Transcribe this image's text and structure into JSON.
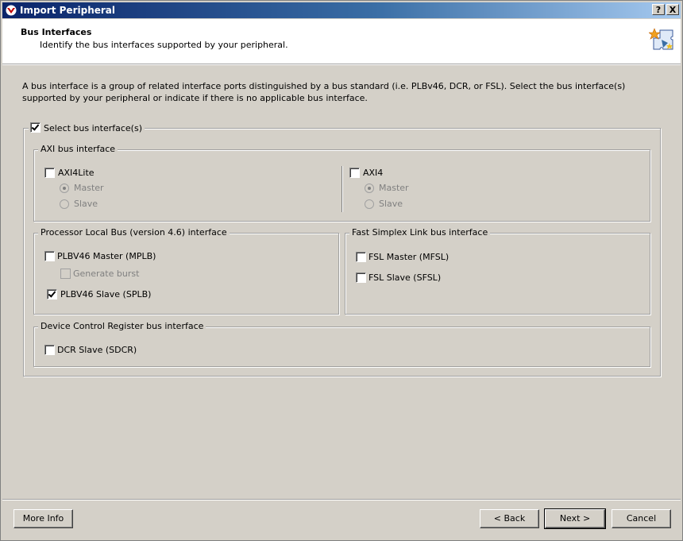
{
  "window": {
    "title": "Import Peripheral",
    "help_label": "?",
    "close_label": "X"
  },
  "header": {
    "title": "Bus Interfaces",
    "subtitle": "Identify the bus interfaces supported by your peripheral."
  },
  "description": "A bus interface is a group of related interface ports distinguished by a bus standard (i.e. PLBv46, DCR, or FSL). Select the bus interface(s) supported by your peripheral or indicate if there is no applicable bus interface.",
  "select_bus": {
    "label": "Select bus interface(s)",
    "checked": true
  },
  "axi": {
    "legend": "AXI bus interface",
    "axi4lite": {
      "label": "AXI4Lite",
      "checked": false,
      "master_label": "Master",
      "slave_label": "Slave",
      "selected": "Master"
    },
    "axi4": {
      "label": "AXI4",
      "checked": false,
      "master_label": "Master",
      "slave_label": "Slave",
      "selected": "Master"
    }
  },
  "plb": {
    "legend": "Processor Local Bus (version 4.6) interface",
    "master": {
      "label": "PLBV46 Master (MPLB)",
      "checked": false
    },
    "burst": {
      "label": "Generate burst",
      "checked": false,
      "enabled": false
    },
    "slave": {
      "label": "PLBV46 Slave (SPLB)",
      "checked": true
    }
  },
  "fsl": {
    "legend": "Fast Simplex Link bus interface",
    "master": {
      "label": "FSL Master (MFSL)",
      "checked": false
    },
    "slave": {
      "label": "FSL Slave (SFSL)",
      "checked": false
    }
  },
  "dcr": {
    "legend": "Device Control Register bus interface",
    "slave": {
      "label": "DCR Slave (SDCR)",
      "checked": false
    }
  },
  "buttons": {
    "more_info": "More Info",
    "back": "< Back",
    "next": "Next >",
    "cancel": "Cancel"
  }
}
